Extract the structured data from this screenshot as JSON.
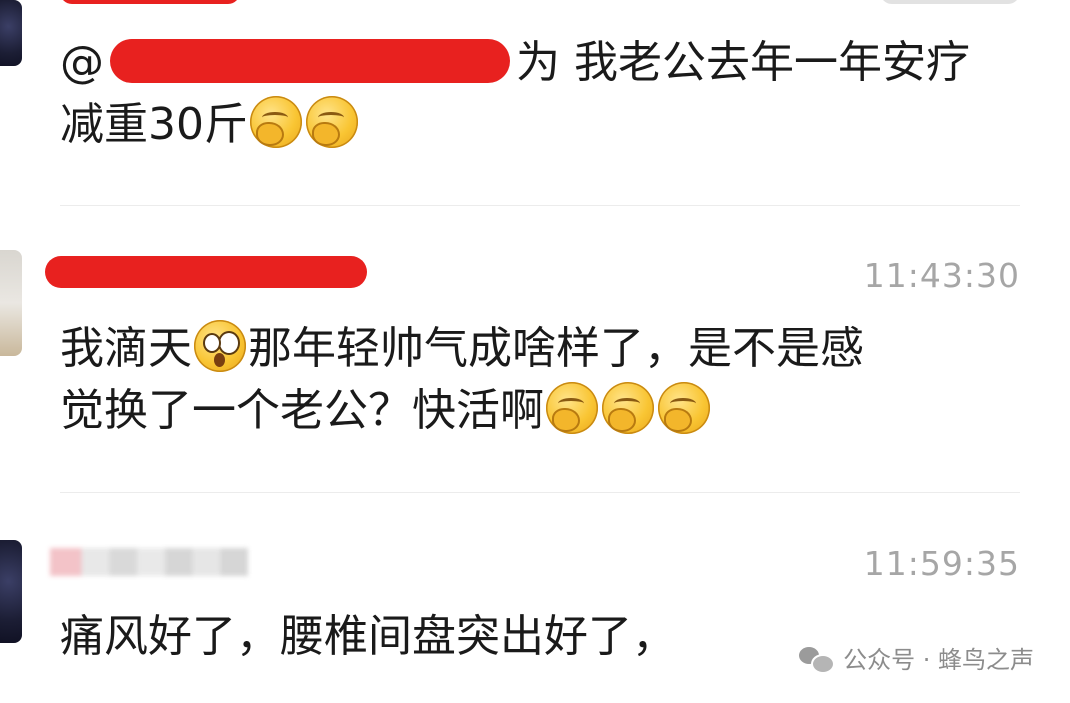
{
  "comments": [
    {
      "time": "",
      "text": "@ 为 我老公去年一年安疗减重30斤",
      "text_line1": "@",
      "text_line1_b": "为 我老公去年一年安疗",
      "text_line2": "减重30斤",
      "emoji_count": 2,
      "emoji_icon": "giggle-emoji-icon"
    },
    {
      "time": "11:43:30",
      "text_line1_a": "我滴天",
      "text_line1_b": "那年轻帅气成啥样了，是不是感",
      "text_line2": "觉换了一个老公？快活啊",
      "emoji_icons": [
        "surprised-emoji-icon",
        "giggle-emoji-icon"
      ]
    },
    {
      "time": "11:59:35",
      "text": "痛风好了，腰椎间盘突出好了，"
    }
  ],
  "watermark": {
    "text": "公众号 · 蜂鸟之声",
    "icon": "wechat-icon"
  },
  "colors": {
    "redaction": "#e8211f",
    "timestamp": "#a6a6a6",
    "emoji": "#f9c533"
  }
}
